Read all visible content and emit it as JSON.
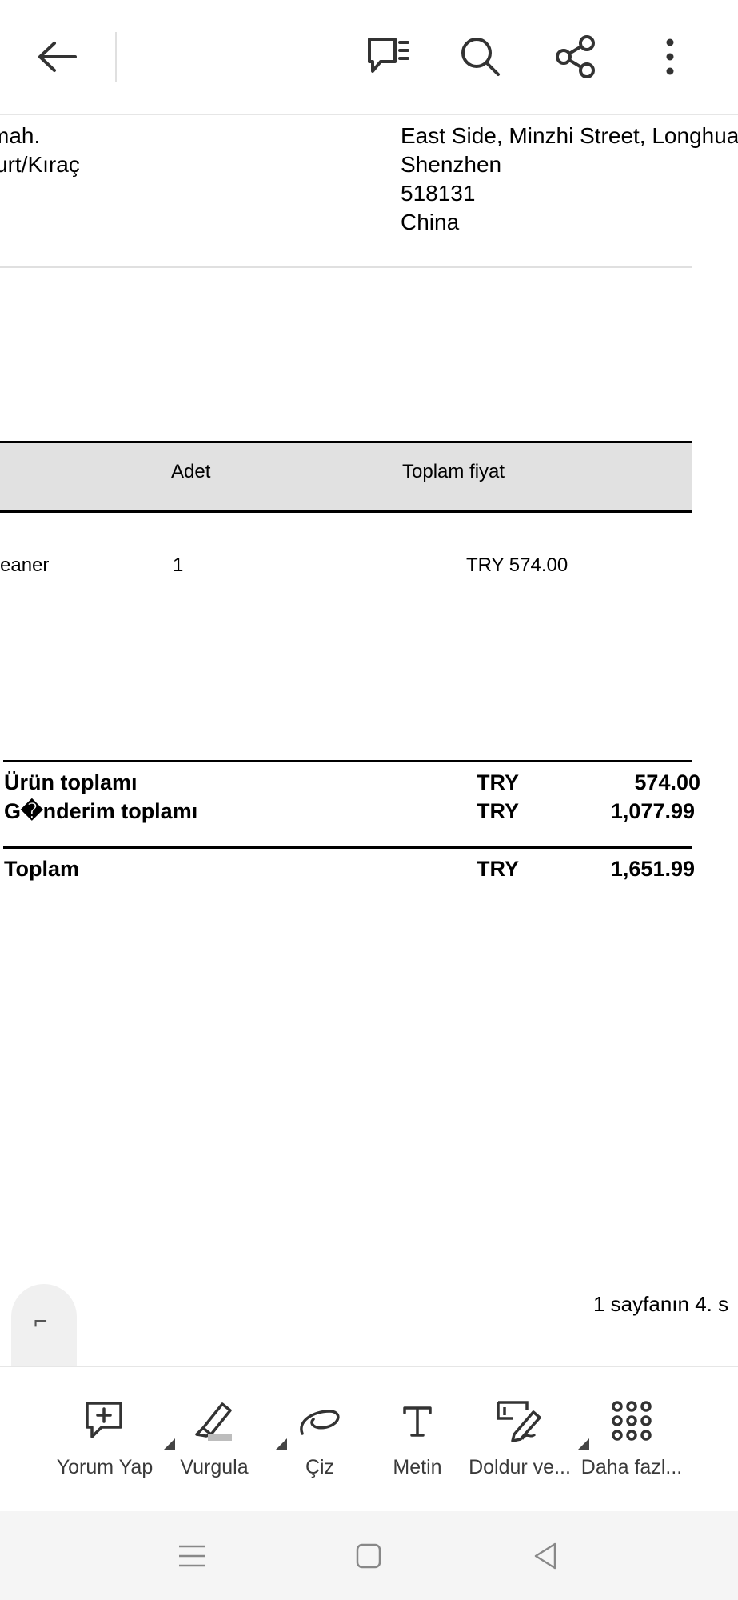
{
  "address_left": {
    "line1": "mah.",
    "line2": "urt/Kıraç"
  },
  "address_right": {
    "line1": "East Side, Minzhi Street, Longhua",
    "line2": "Shenzhen",
    "line3": "518131",
    "line4": "China"
  },
  "table": {
    "headers": {
      "qty": "Adet",
      "total": "Toplam fiyat"
    },
    "row": {
      "item": "eaner",
      "qty": "1",
      "total": "TRY 574.00"
    }
  },
  "totals": {
    "subtotal": {
      "label": "Ürün toplamı",
      "currency": "TRY",
      "amount": "574.00"
    },
    "shipping": {
      "label": "G�nderim toplamı",
      "currency": "TRY",
      "amount": "1,077.99"
    },
    "grand": {
      "label": "Toplam",
      "currency": "TRY",
      "amount": "1,651.99"
    }
  },
  "page_indicator": "1 sayfanın 4. s",
  "page_handle_glyph": "⌐",
  "toolbar": {
    "comment": "Yorum Yap",
    "highlight": "Vurgula",
    "draw": "Çiz",
    "text": "Metin",
    "fill_sign": "Doldur ve...",
    "more": "Daha fazl..."
  },
  "icons": {
    "back": "arrow-left-icon",
    "comments": "comment-list-icon",
    "search": "search-icon",
    "share": "share-icon",
    "more": "more-vertical-icon"
  }
}
